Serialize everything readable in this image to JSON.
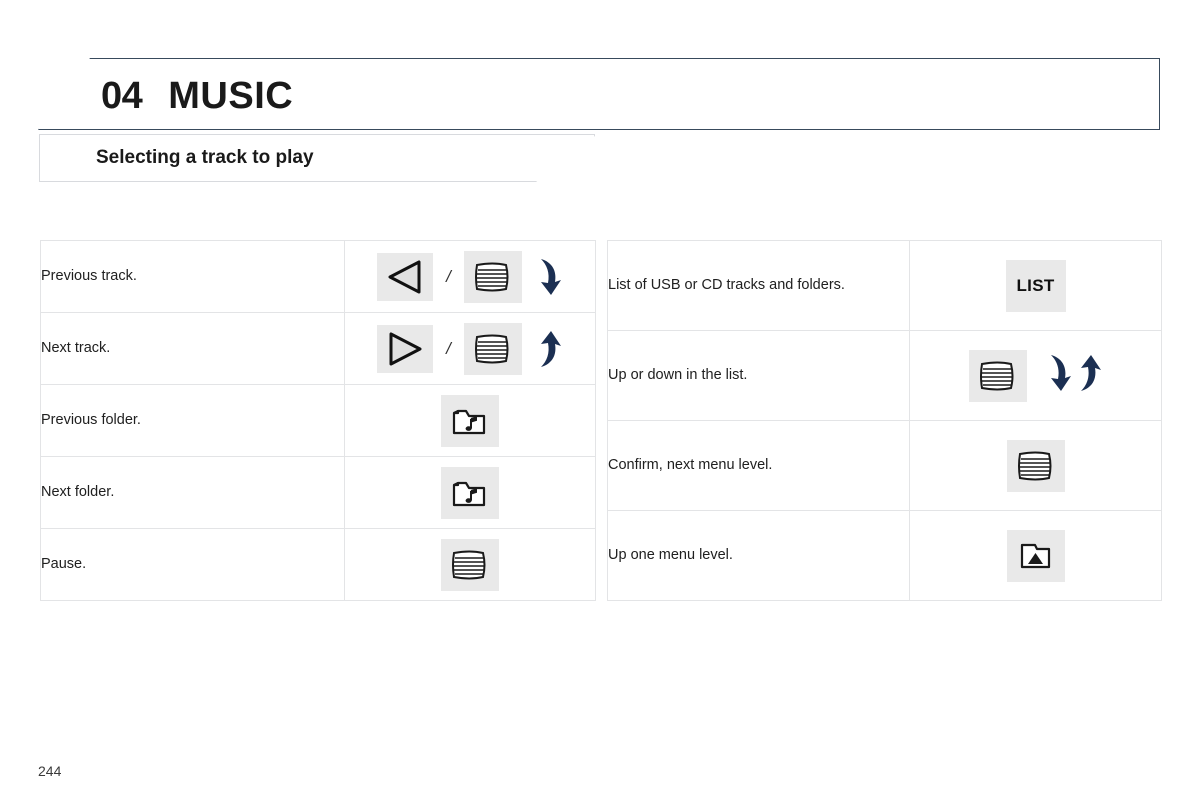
{
  "chapter": {
    "number": "04",
    "title": "MUSIC"
  },
  "section": {
    "title": "Selecting a track to play"
  },
  "colors": {
    "header_border": "#384a5c",
    "arrow_navy": "#1b2f52",
    "keycap_bg": "#e9e9e9",
    "table_border": "#e3e4e6"
  },
  "tables": {
    "left": {
      "rows": [
        {
          "description": "Previous track.",
          "controls": [
            {
              "type": "keycap",
              "icon": "triangle-left-icon",
              "label": ""
            },
            {
              "type": "separator",
              "label": "/"
            },
            {
              "type": "keycap",
              "icon": "rotary-knob-icon",
              "label": ""
            },
            {
              "type": "arrow",
              "icon": "curved-arrow-down-icon",
              "label": ""
            }
          ]
        },
        {
          "description": "Next track.",
          "controls": [
            {
              "type": "keycap",
              "icon": "triangle-right-icon",
              "label": ""
            },
            {
              "type": "separator",
              "label": "/"
            },
            {
              "type": "keycap",
              "icon": "rotary-knob-icon",
              "label": ""
            },
            {
              "type": "arrow",
              "icon": "curved-arrow-up-icon",
              "label": ""
            }
          ]
        },
        {
          "description": "Previous folder.",
          "controls": [
            {
              "type": "keycap",
              "icon": "folder-music-icon",
              "label": ""
            }
          ]
        },
        {
          "description": "Next folder.",
          "controls": [
            {
              "type": "keycap",
              "icon": "folder-music-icon",
              "label": ""
            }
          ]
        },
        {
          "description": "Pause.",
          "controls": [
            {
              "type": "keycap",
              "icon": "rotary-knob-icon",
              "label": ""
            }
          ]
        }
      ]
    },
    "right": {
      "rows": [
        {
          "description": "List of USB or CD tracks and folders.",
          "controls": [
            {
              "type": "keycap-text",
              "icon": "list-button-icon",
              "label": "LIST"
            }
          ]
        },
        {
          "description": "Up or down in the list.",
          "controls": [
            {
              "type": "keycap",
              "icon": "rotary-knob-icon",
              "label": ""
            },
            {
              "type": "arrow",
              "icon": "curved-arrow-down-icon",
              "label": ""
            },
            {
              "type": "arrow",
              "icon": "curved-arrow-up-icon",
              "label": ""
            }
          ]
        },
        {
          "description": "Confirm, next menu level.",
          "controls": [
            {
              "type": "keycap",
              "icon": "rotary-knob-icon",
              "label": ""
            }
          ]
        },
        {
          "description": "Up one menu level.",
          "controls": [
            {
              "type": "keycap",
              "icon": "folder-up-icon",
              "label": ""
            }
          ]
        }
      ]
    }
  },
  "footer": {
    "page_number": "244"
  }
}
